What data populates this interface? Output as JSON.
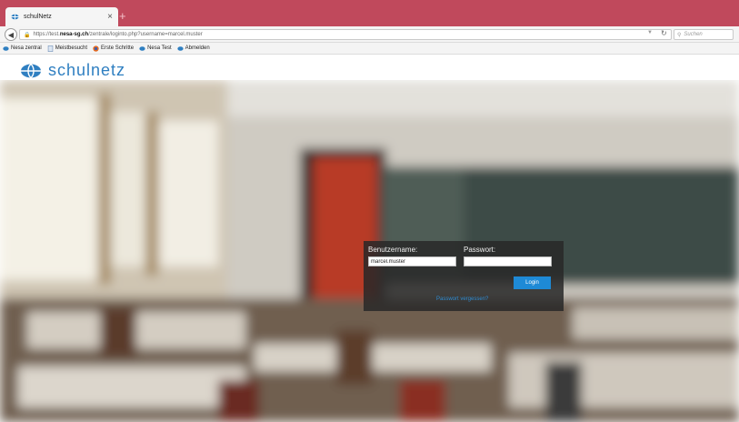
{
  "browser": {
    "tab_title": "schulNetz",
    "tab_close": "×",
    "new_tab": "+",
    "url_prefix": "https://test.",
    "url_domain": "nesa-sg.ch",
    "url_path": "/zentrale/loginto.php?username=marcel.muster",
    "search_placeholder": "Suchen"
  },
  "bookmarks": [
    {
      "label": "Nesa zentral",
      "icon": "nesa-icon"
    },
    {
      "label": "Meistbesucht",
      "icon": "document-icon"
    },
    {
      "label": "Erste Schritte",
      "icon": "firefox-icon"
    },
    {
      "label": "Nesa Test",
      "icon": "nesa-icon"
    },
    {
      "label": "Abmelden",
      "icon": "nesa-icon"
    }
  ],
  "header": {
    "logo_text": "schulnetz"
  },
  "login": {
    "username_label": "Benutzername:",
    "username_value": "marcel.muster",
    "password_label": "Passwort:",
    "password_value": "",
    "login_button": "Login",
    "forgot_link": "Passwort vergessen?"
  },
  "colors": {
    "tabstrip": "#c0495c",
    "brand": "#2f7fc1",
    "button": "#1e8ad6",
    "login_bg": "#282828"
  }
}
